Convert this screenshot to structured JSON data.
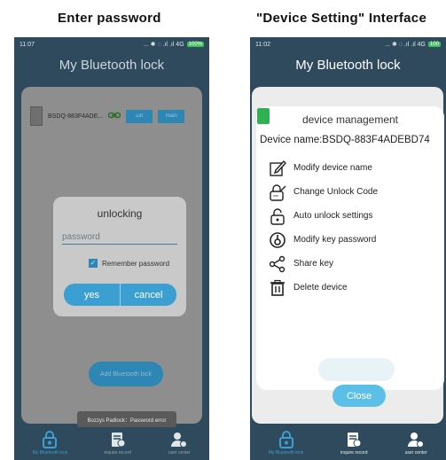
{
  "captions": {
    "left": "Enter password",
    "right": "\"Device Setting\" Interface"
  },
  "left_phone": {
    "status": {
      "time": "11:07",
      "icons": "... ✱ ◌ .ıl .ıl 4G",
      "battery": "100%"
    },
    "app_title": "My Bluetooth lock",
    "lock": {
      "name": "BSDQ-883F4ADE...",
      "link_icon": "link-icon",
      "btn1": "ωn",
      "btn2": "main"
    },
    "dialog": {
      "title": "unlocking",
      "password_placeholder": "password",
      "remember_label": "Remember password",
      "remember_checked": true,
      "yes_label": "yes",
      "cancel_label": "cancel"
    },
    "add_lock_label": "Add Bluetooth lock",
    "toast": "Bozzys Padlock：Password error",
    "tabs": [
      {
        "label": "My Bluetooth lock",
        "icon": "lock-icon",
        "active": true
      },
      {
        "label": "inquire record",
        "icon": "record-icon",
        "active": false
      },
      {
        "label": "user center",
        "icon": "user-settings-icon",
        "active": false
      }
    ]
  },
  "right_phone": {
    "status": {
      "time": "11:02",
      "icons": "... ✱ ◌ .ıl .ıl 4G",
      "battery": "100"
    },
    "app_title": "My Bluetooth lock",
    "dialog": {
      "title": "device management",
      "device_name": "Device name:BSDQ-883F4ADEBD74",
      "menu": [
        {
          "label": "Modify device name",
          "icon": "edit-icon"
        },
        {
          "label": "Change Unlock Code",
          "icon": "lock-code-icon"
        },
        {
          "label": "Auto unlock settings",
          "icon": "auto-unlock-icon"
        },
        {
          "label": "Modify key password",
          "icon": "key-password-icon"
        },
        {
          "label": "Share key",
          "icon": "share-icon"
        },
        {
          "label": "Delete device",
          "icon": "trash-icon"
        }
      ],
      "close_label": "Close"
    },
    "tabs": [
      {
        "label": "My Bluetooth lock",
        "icon": "lock-icon",
        "active": true
      },
      {
        "label": "inquire record",
        "icon": "record-icon",
        "active": false
      },
      {
        "label": "user center",
        "icon": "user-settings-icon",
        "active": false
      }
    ]
  }
}
